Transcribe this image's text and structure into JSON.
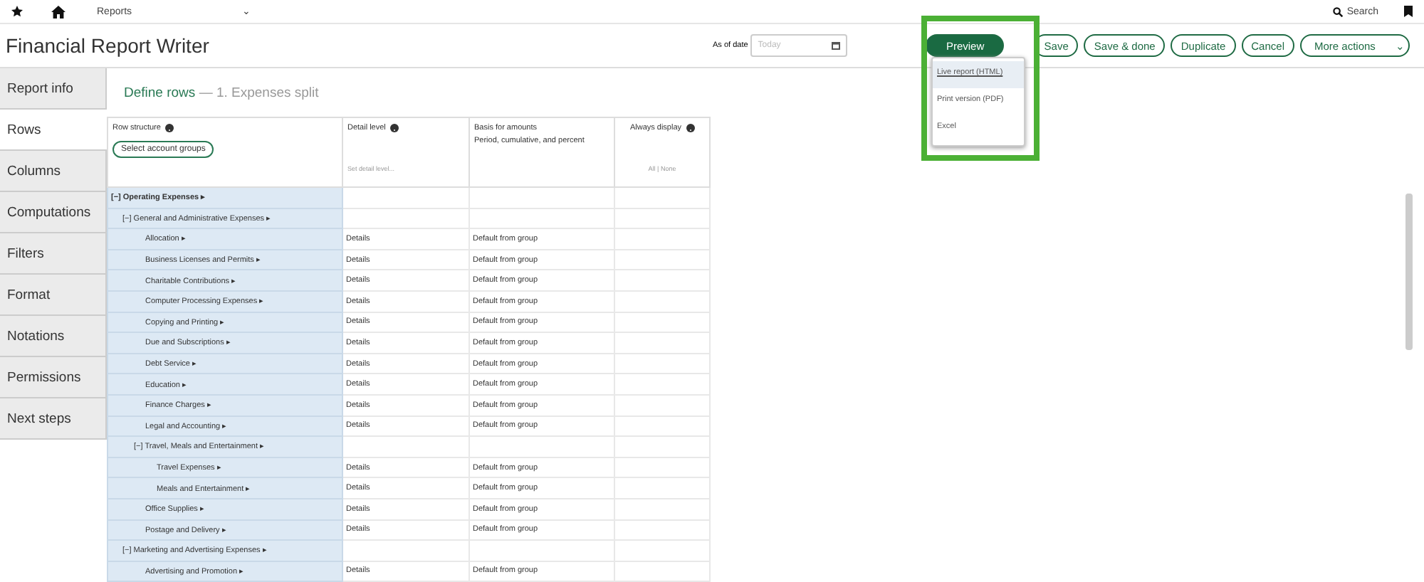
{
  "topbar": {
    "section": "Reports",
    "caret": "⌄",
    "search": "Search"
  },
  "title": "Financial Report Writer",
  "as_of": {
    "label": "As of date",
    "placeholder": "Today"
  },
  "actions": [
    {
      "label": "Preview",
      "kind": "primary"
    },
    {
      "label": "Save",
      "kind": "outline"
    },
    {
      "label": "Save & done",
      "kind": "outline"
    },
    {
      "label": "Duplicate",
      "kind": "outline"
    },
    {
      "label": "Cancel",
      "kind": "outline"
    },
    {
      "label": "More actions",
      "kind": "menu",
      "caret": "⌄"
    }
  ],
  "preview_menu": [
    {
      "label": "Live report (HTML)",
      "selected": true
    },
    {
      "label": "Print version (PDF)",
      "selected": false
    },
    {
      "label": "Excel",
      "selected": false
    }
  ],
  "tabs": [
    {
      "label": "Report info",
      "selected": false
    },
    {
      "label": "Rows",
      "selected": true
    },
    {
      "label": "Columns",
      "selected": false
    },
    {
      "label": "Computations",
      "selected": false
    },
    {
      "label": "Filters",
      "selected": false
    },
    {
      "label": "Format",
      "selected": false
    },
    {
      "label": "Notations",
      "selected": false
    },
    {
      "label": "Permissions",
      "selected": false
    },
    {
      "label": "Next steps",
      "selected": false
    }
  ],
  "heading": {
    "title": "Define rows",
    "subtitle": "— 1. Expenses split"
  },
  "table": {
    "columns": [
      {
        "label": "Row structure",
        "help": true,
        "button": "Select account groups"
      },
      {
        "label": "Detail level",
        "help": true,
        "hint": "Set detail level..."
      },
      {
        "label": "Basis for amounts",
        "sub": "Period, cumulative, and percent"
      },
      {
        "label": "Always display",
        "help": true,
        "hint": "All | None"
      }
    ],
    "rows": [
      {
        "toggle": "[−]",
        "label": "Operating Expenses",
        "arrow": "▸",
        "bold": true,
        "children": [
          {
            "toggle": "[−]",
            "label": "General and Administrative Expenses",
            "arrow": "▸",
            "children": [
              {
                "label": "Allocation",
                "arrow": "▸",
                "detail": "Details",
                "basis": "Default from group"
              },
              {
                "label": "Business Licenses and Permits",
                "arrow": "▸",
                "detail": "Details",
                "basis": "Default from group"
              },
              {
                "label": "Charitable Contributions",
                "arrow": "▸",
                "detail": "Details",
                "basis": "Default from group"
              },
              {
                "label": "Computer Processing Expenses",
                "arrow": "▸",
                "detail": "Details",
                "basis": "Default from group"
              },
              {
                "label": "Copying and Printing",
                "arrow": "▸",
                "detail": "Details",
                "basis": "Default from group"
              },
              {
                "label": "Due and Subscriptions",
                "arrow": "▸",
                "detail": "Details",
                "basis": "Default from group"
              },
              {
                "label": "Debt Service",
                "arrow": "▸",
                "detail": "Details",
                "basis": "Default from group"
              },
              {
                "label": "Education",
                "arrow": "▸",
                "detail": "Details",
                "basis": "Default from group"
              },
              {
                "label": "Finance Charges",
                "arrow": "▸",
                "detail": "Details",
                "basis": "Default from group"
              },
              {
                "label": "Legal and Accounting",
                "arrow": "▸",
                "detail": "Details",
                "basis": "Default from group"
              },
              {
                "toggle": "[−]",
                "label": "Travel, Meals and Entertainment",
                "arrow": "▸",
                "children": [
                  {
                    "label": "Travel Expenses",
                    "arrow": "▸",
                    "detail": "Details",
                    "basis": "Default from group"
                  },
                  {
                    "label": "Meals and Entertainment",
                    "arrow": "▸",
                    "detail": "Details",
                    "basis": "Default from group"
                  }
                ]
              },
              {
                "label": "Office Supplies",
                "arrow": "▸",
                "detail": "Details",
                "basis": "Default from group"
              },
              {
                "label": "Postage and Delivery",
                "arrow": "▸",
                "detail": "Details",
                "basis": "Default from group"
              }
            ]
          },
          {
            "toggle": "[−]",
            "label": "Marketing and Advertising Expenses",
            "arrow": "▸",
            "children": [
              {
                "label": "Advertising and Promotion",
                "arrow": "▸",
                "detail": "Details",
                "basis": "Default from group"
              }
            ]
          }
        ]
      }
    ]
  }
}
